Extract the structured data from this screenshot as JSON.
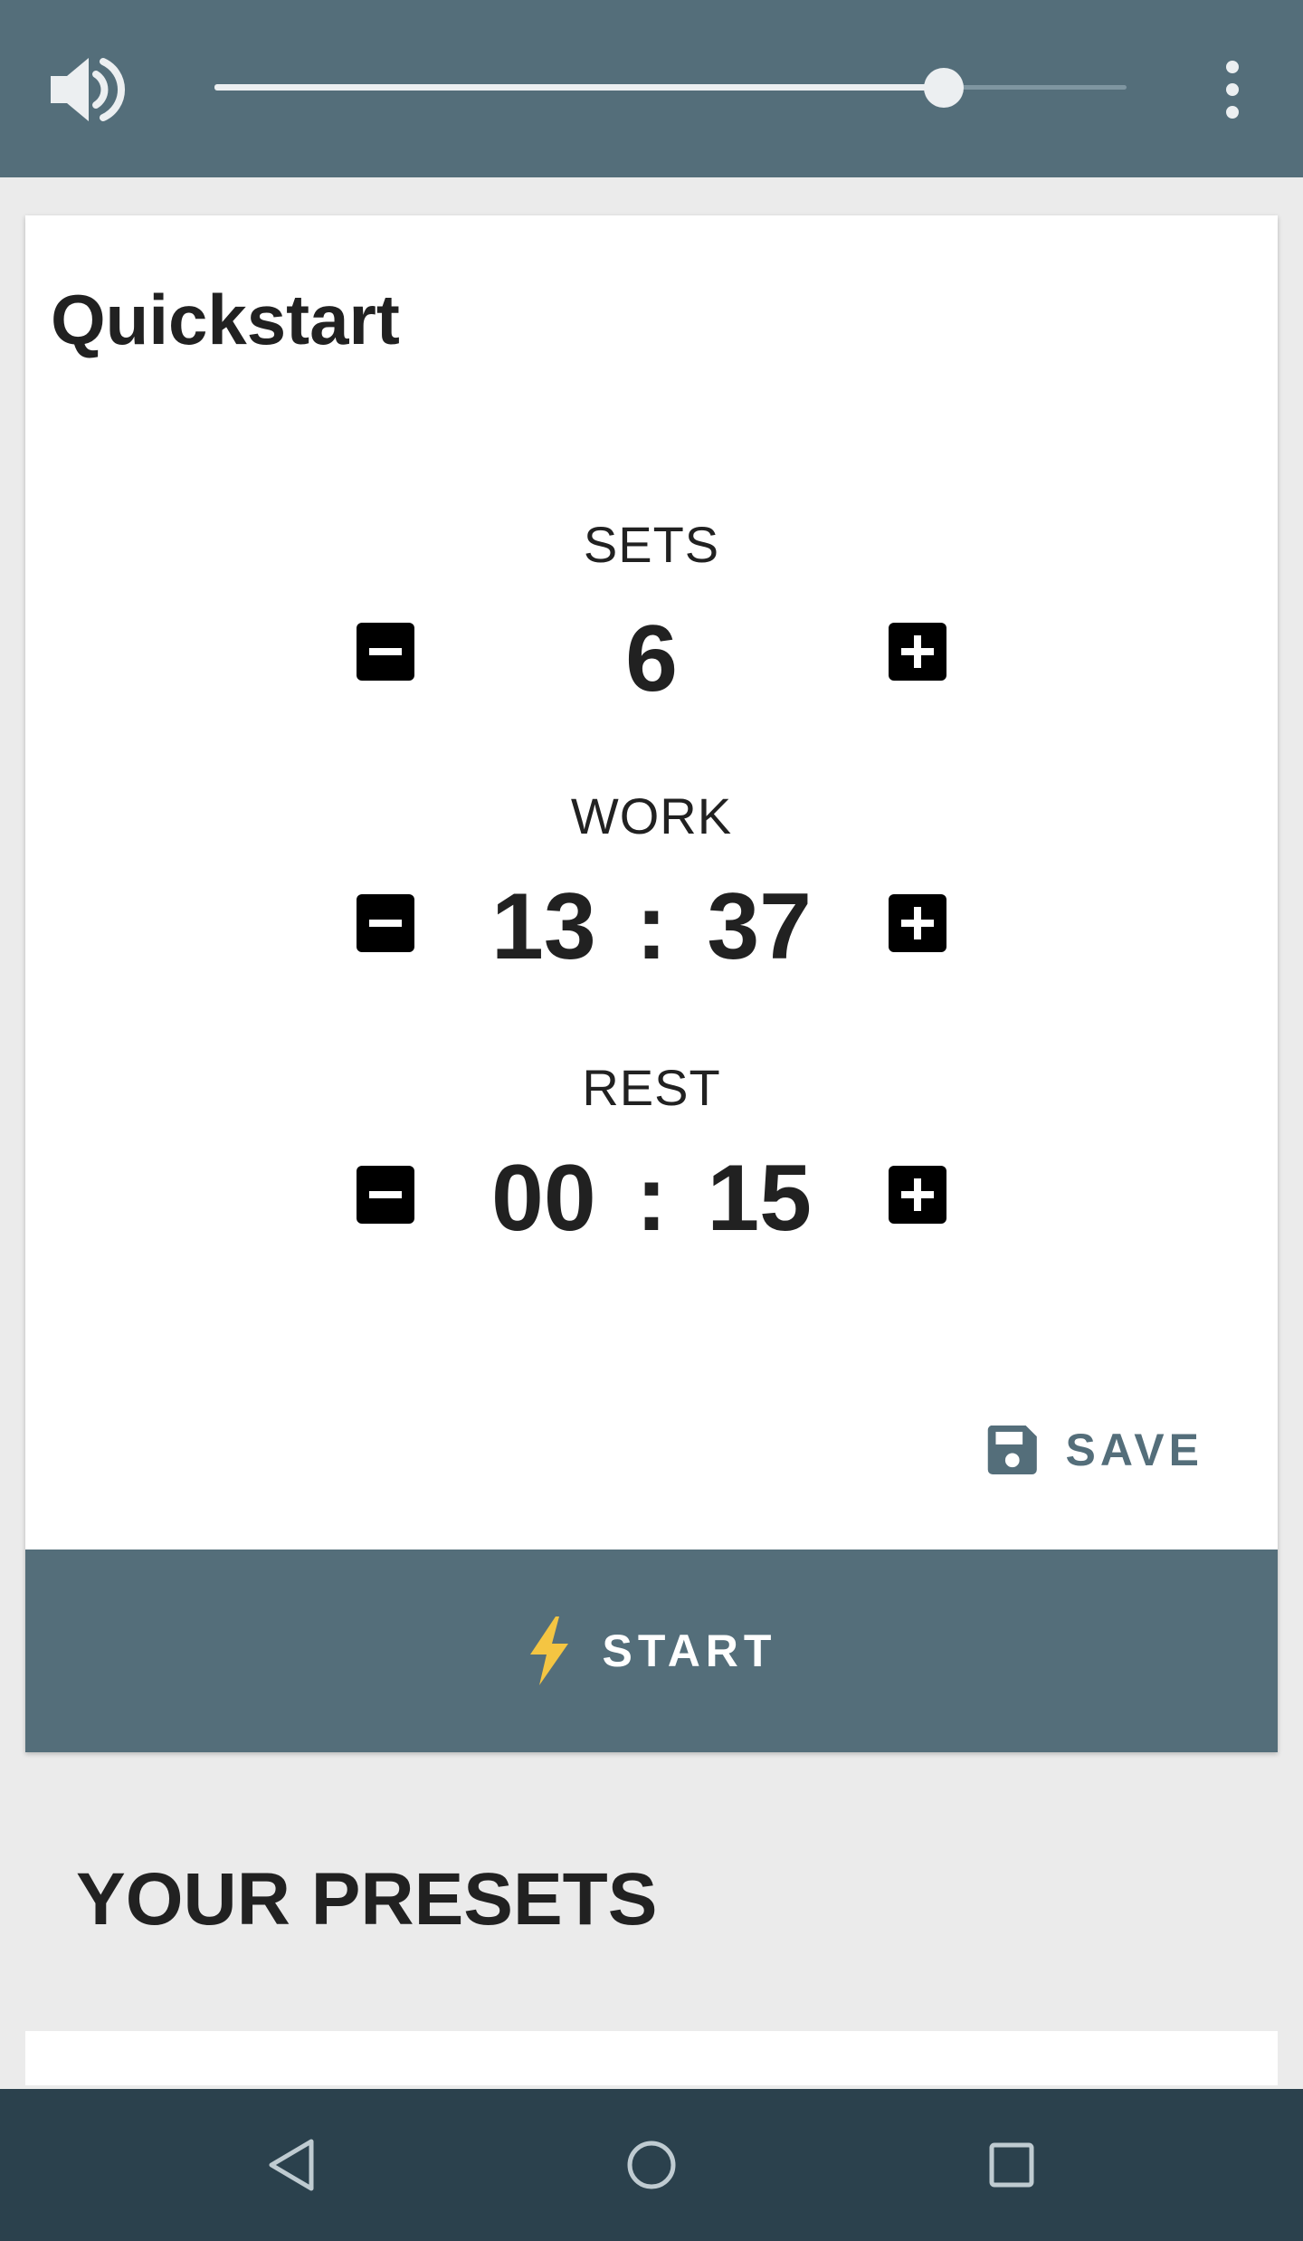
{
  "topbar": {
    "volume_icon": "volume-up-icon",
    "volume_level": 0.8,
    "menu_icon": "more-vert-icon"
  },
  "quickstart": {
    "title": "Quickstart",
    "sets": {
      "label": "SETS",
      "value": "6"
    },
    "work": {
      "label": "WORK",
      "minutes": "13",
      "separator": ":",
      "seconds": "37"
    },
    "rest": {
      "label": "REST",
      "minutes": "00",
      "separator": ":",
      "seconds": "15"
    },
    "decrement_icon": "minus-box-icon",
    "increment_icon": "plus-box-icon",
    "save": {
      "label": "SAVE",
      "icon": "floppy-disk-icon"
    },
    "start": {
      "label": "START",
      "icon": "lightning-bolt-icon"
    }
  },
  "presets": {
    "title": "YOUR PRESETS"
  },
  "navbar": {
    "back_icon": "back-triangle-icon",
    "home_icon": "home-circle-icon",
    "recents_icon": "recents-square-icon"
  },
  "colors": {
    "primary": "#546e7a",
    "nav_bar": "#2b414d",
    "background": "#ebebeb",
    "accent_bolt": "#f4c542",
    "text": "#212121"
  }
}
